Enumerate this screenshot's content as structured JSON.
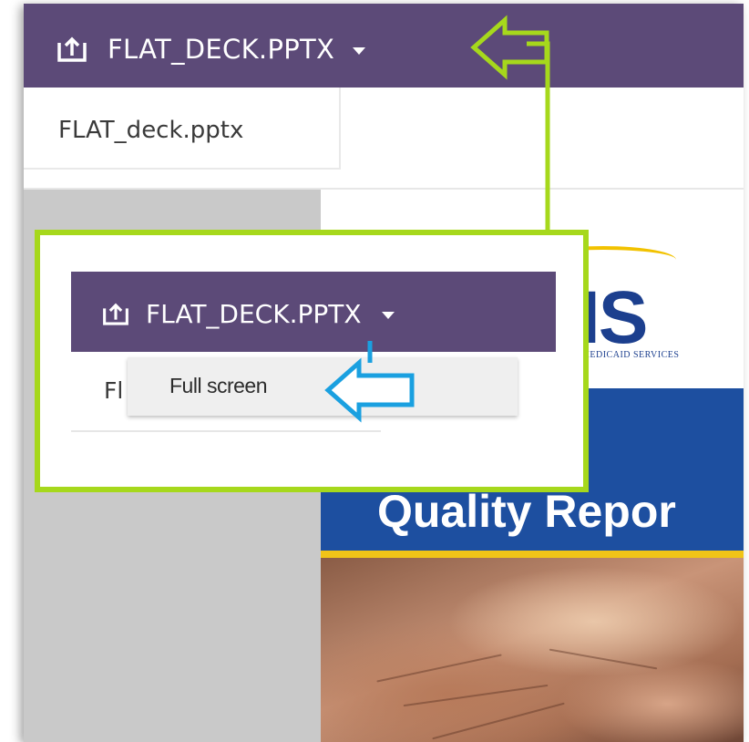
{
  "toolbar": {
    "title": "FLAT_DECK.PPTX"
  },
  "tabs": [
    {
      "label": "FLAT_deck.pptx"
    }
  ],
  "slide": {
    "logo_text": "IS",
    "logo_subtext": "MEDICAID SERVICES",
    "banner_title": "Quality Repor"
  },
  "callout": {
    "toolbar_title": "FLAT_DECK.PPTX",
    "tab_label": "Fl",
    "menu": {
      "items": [
        {
          "label": "Full screen"
        }
      ]
    }
  },
  "colors": {
    "toolbar_bg": "#5c4a78",
    "callout_border": "#a6d81c",
    "pointer_arrow": "#1aa0e0",
    "banner_bg": "#1d4fa0",
    "accent_stripe": "#f0c418"
  },
  "icons": {
    "upload": "upload-icon",
    "dropdown": "chevron-down-icon",
    "callout_arrow": "arrow-left-icon",
    "pointer_arrow": "arrow-left-icon"
  }
}
